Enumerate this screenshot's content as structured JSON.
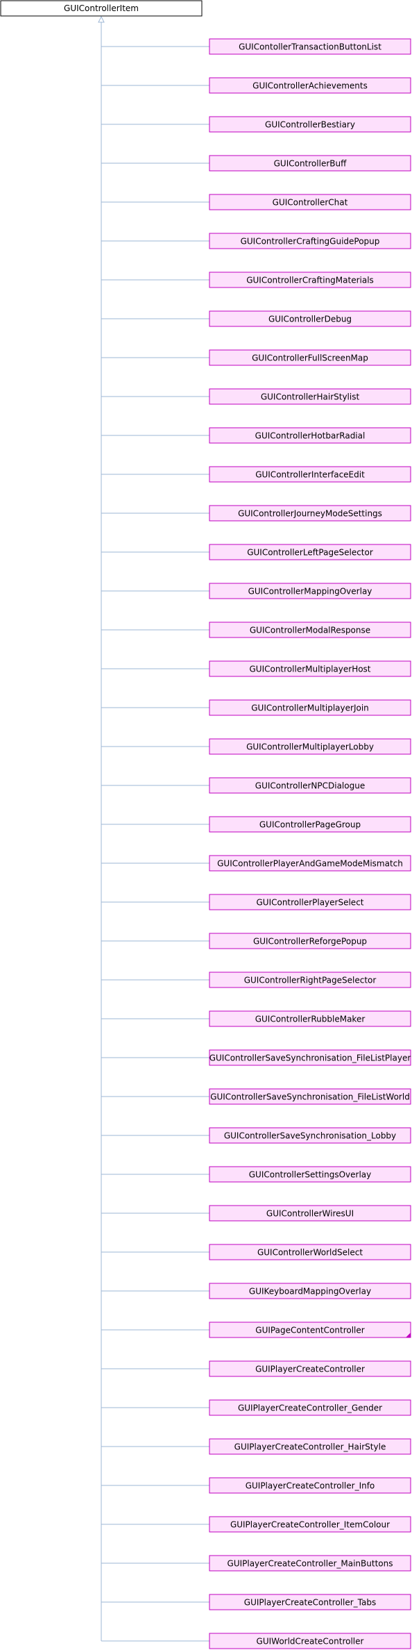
{
  "diagram": {
    "base_class": "GUIControllerItem",
    "colors": {
      "base_fill": "#ffffff",
      "base_stroke": "#000000",
      "child_fill": "#fde0fc",
      "child_stroke": "#c000c0",
      "edge": "#9eb7d5"
    },
    "derived_classes": [
      "GUIContollerTransactionButtonList",
      "GUIControllerAchievements",
      "GUIControllerBestiary",
      "GUIControllerBuff",
      "GUIControllerChat",
      "GUIControllerCraftingGuidePopup",
      "GUIControllerCraftingMaterials",
      "GUIControllerDebug",
      "GUIControllerFullScreenMap",
      "GUIControllerHairStylist",
      "GUIControllerHotbarRadial",
      "GUIControllerInterfaceEdit",
      "GUIControllerJourneyModeSettings",
      "GUIControllerLeftPageSelector",
      "GUIControllerMappingOverlay",
      "GUIControllerModalResponse",
      "GUIControllerMultiplayerHost",
      "GUIControllerMultiplayerJoin",
      "GUIControllerMultiplayerLobby",
      "GUIControllerNPCDialogue",
      "GUIControllerPageGroup",
      "GUIControllerPlayerAndGameModeMismatch",
      "GUIControllerPlayerSelect",
      "GUIControllerReforgePopup",
      "GUIControllerRightPageSelector",
      "GUIControllerRubbleMaker",
      "GUIControllerSaveSynchronisation_FileListPlayer",
      "GUIControllerSaveSynchronisation_FileListWorld",
      "GUIControllerSaveSynchronisation_Lobby",
      "GUIControllerSettingsOverlay",
      "GUIControllerWiresUI",
      "GUIControllerWorldSelect",
      "GUIKeyboardMappingOverlay",
      "GUIPageContentController",
      "GUIPlayerCreateController",
      "GUIPlayerCreateController_Gender",
      "GUIPlayerCreateController_HairStyle",
      "GUIPlayerCreateController_Info",
      "GUIPlayerCreateController_ItemColour",
      "GUIPlayerCreateController_MainButtons",
      "GUIPlayerCreateController_Tabs",
      "GUIWorldCreateController"
    ],
    "has_more_subclasses": [
      "GUIPageContentController"
    ]
  }
}
